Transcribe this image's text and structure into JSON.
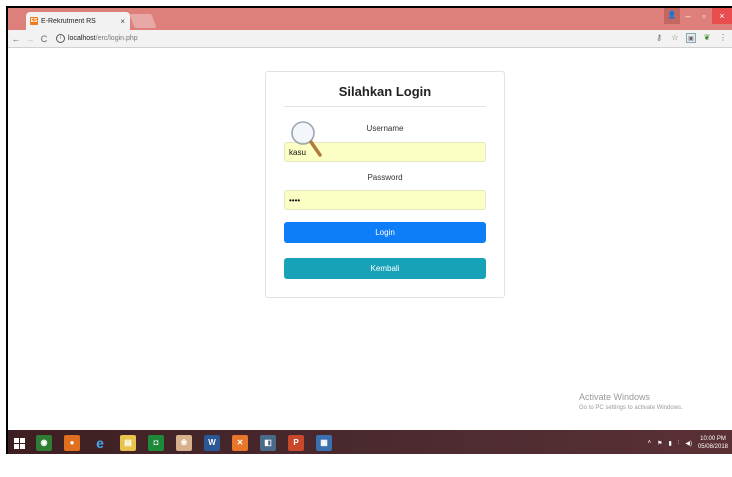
{
  "browser": {
    "tab_title": "E-Rekrutment RS",
    "tab_close": "×",
    "url_host": "localhost",
    "url_path": "/erc/login.php",
    "user_icon": "user-icon",
    "minimize": "–",
    "maximize": "▫",
    "close": "×"
  },
  "login": {
    "title": "Silahkan Login",
    "username_label": "Username",
    "username_value": "kasu",
    "password_label": "Password",
    "password_value": "kasu",
    "login_button": "Login",
    "back_button": "Kembali"
  },
  "watermark": {
    "line1": "Activate Windows",
    "line2": "Go to PC settings to activate Windows."
  },
  "taskbar": {
    "time": "10:00 PM",
    "date": "05/08/2018"
  },
  "colors": {
    "tab_bar": "#dd7f7a",
    "primary_button": "#0d7ef7",
    "info_button": "#17a2b8",
    "autofill_input": "#fbffc4"
  }
}
